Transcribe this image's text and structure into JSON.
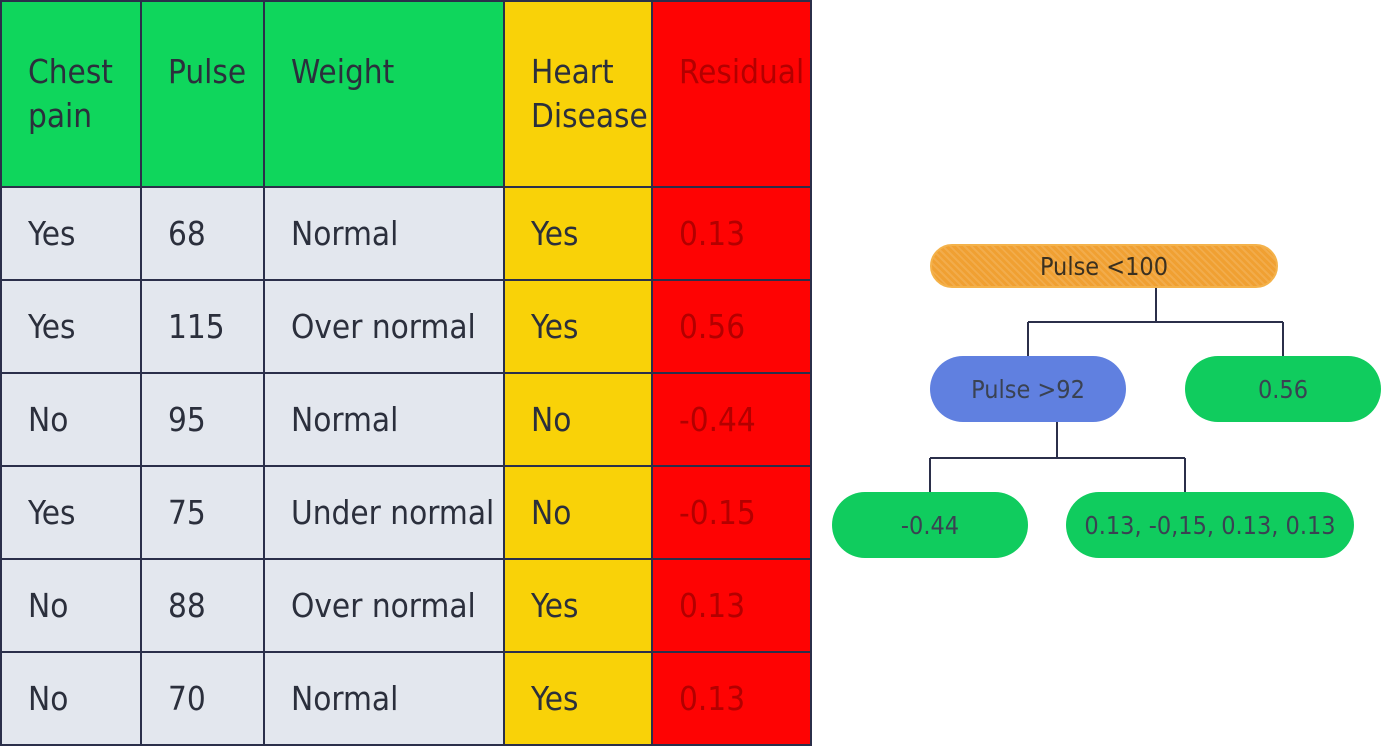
{
  "table": {
    "headers": [
      "Chest pain",
      "Pulse",
      "Weight",
      "Heart Disease",
      "Residual"
    ],
    "rows": [
      [
        "Yes",
        "68",
        "Normal",
        "Yes",
        "0.13"
      ],
      [
        "Yes",
        "115",
        "Over normal",
        "Yes",
        "0.56"
      ],
      [
        "No",
        "95",
        "Normal",
        "No",
        "-0.44"
      ],
      [
        "Yes",
        "75",
        "Under normal",
        "No",
        "-0.15"
      ],
      [
        "No",
        "88",
        "Over normal",
        "Yes",
        "0.13"
      ],
      [
        "No",
        "70",
        "Normal",
        "Yes",
        "0.13"
      ]
    ],
    "colors": {
      "feature_header": "#0fd65c",
      "target_header": "#f9d208",
      "residual": "#fe0303",
      "feature_cell": "#e3e7ee"
    }
  },
  "tree": {
    "root": "Pulse <100",
    "split": "Pulse >92",
    "leaf_right": "0.56",
    "leaf_split_left": "-0.44",
    "leaf_split_right": "0.13, -0,15, 0.13, 0.13",
    "colors": {
      "root": "#f0a032",
      "split": "#6080e0",
      "leaf": "#10cc5e",
      "edge": "#2b2f4a"
    }
  }
}
